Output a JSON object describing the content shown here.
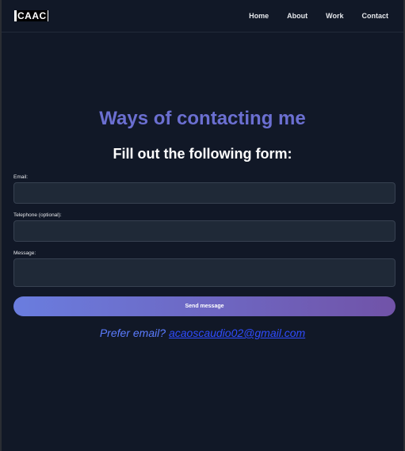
{
  "navbar": {
    "logo": "CAAC",
    "links": [
      "Home",
      "About",
      "Work",
      "Contact"
    ]
  },
  "main": {
    "heading": "Ways of contacting me",
    "subheading": "Fill out the following form:"
  },
  "form": {
    "email_label": "Email:",
    "email_value": "",
    "telephone_label": "Telephone (optional):",
    "telephone_value": "",
    "message_label": "Message:",
    "message_value": "",
    "send_label": "Send message"
  },
  "footer": {
    "prefer_text": "Prefer email?",
    "email_link": "acaoscaudio02@gmail.com"
  },
  "colors": {
    "background": "#111827",
    "heading": "#6b6fd1",
    "input_bg": "#1f2937",
    "button_start": "#6a7ddf",
    "button_end": "#7153a8",
    "link": "#2f4cff"
  }
}
